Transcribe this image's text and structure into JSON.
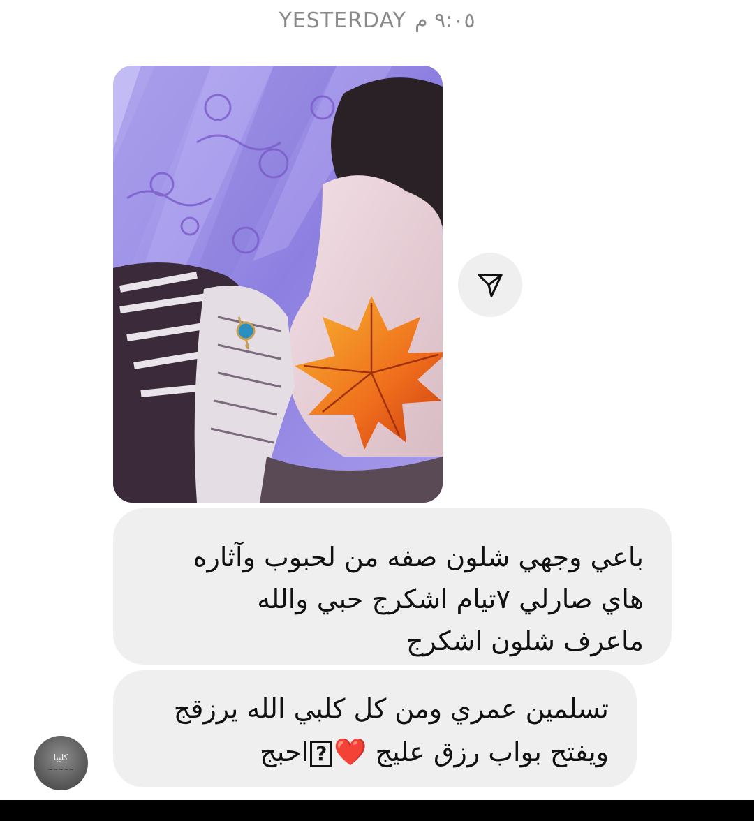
{
  "timestamp": {
    "time": "٩:٠٥ م",
    "day": "YESTERDAY"
  },
  "photo_message": {
    "icon": "photo-attachment"
  },
  "share_button": {
    "icon": "send-arrow-icon"
  },
  "messages": [
    {
      "lines": [
        "باعي وجهي شلون صفه من لحبوب وآثاره",
        "هاي صارلي ٧تيام اشكرج حبي والله",
        "ماعرف شلون اشكرج"
      ]
    },
    {
      "line1": "تسلمين عمري ومن كل كلبي الله يرزقج",
      "line2_start": "ويفتح بواب رزق عليج",
      "emoji_heart": "❤️",
      "unknown_glyph": "?",
      "line2_end": "احبج"
    }
  ],
  "avatar": {
    "text": "كلبيا",
    "subtext": "~~~~~"
  },
  "colors": {
    "bubble": "#efefef",
    "timestamp": "#8a8a8a",
    "heart": "#e0182c"
  }
}
